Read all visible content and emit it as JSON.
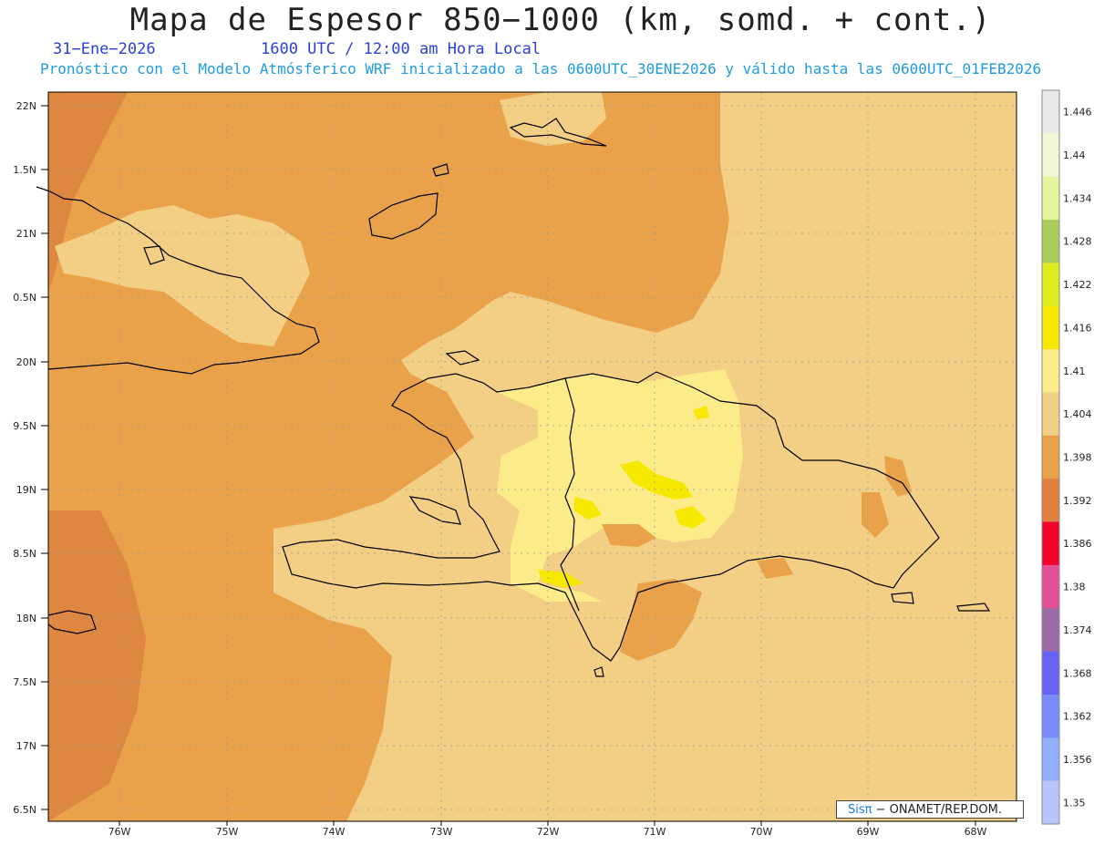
{
  "title": "Mapa de Espesor 850−1000 (km, somd. + cont.)",
  "date": "31−Ene−2026",
  "time": "1600 UTC / 12:00 am Hora Local",
  "info": "Pronóstico con el Modelo Atmósferico WRF inicializado a las 0600UTC_30ENE2026 y válido hasta las  0600UTC_01FEB2026",
  "credit": {
    "logo": "Sisπ",
    "text": " − ONAMET/REP.DOM."
  },
  "axes": {
    "lat_labels": [
      "22N",
      "1.5N",
      "21N",
      "0.5N",
      "20N",
      "9.5N",
      "19N",
      "8.5N",
      "18N",
      "7.5N",
      "17N",
      "6.5N"
    ],
    "lon_labels": [
      "76W",
      "75W",
      "74W",
      "73W",
      "72W",
      "71W",
      "70W",
      "69W",
      "68W"
    ]
  },
  "colorbar": {
    "labels": [
      "1.446",
      "1.44",
      "1.434",
      "1.428",
      "1.422",
      "1.416",
      "1.41",
      "1.404",
      "1.398",
      "1.392",
      "1.386",
      "1.38",
      "1.374",
      "1.368",
      "1.362",
      "1.356",
      "1.35"
    ],
    "colors": [
      "#e8e8e8",
      "#f3f6d4",
      "#e3f59e",
      "#a9cc5a",
      "#dcec1d",
      "#f6e800",
      "#fbec89",
      "#f2cf84",
      "#e9a24a",
      "#df8040",
      "#f0042c",
      "#e55097",
      "#9a6ba8",
      "#6a62f5",
      "#7a8bfb",
      "#93adfd",
      "#b6c6fd"
    ]
  },
  "fill_colors": {
    "deep": "#dd8740",
    "main": "#e9a24a",
    "light": "#f2cf84",
    "pale": "#fbec89",
    "bright": "#f6e800"
  }
}
